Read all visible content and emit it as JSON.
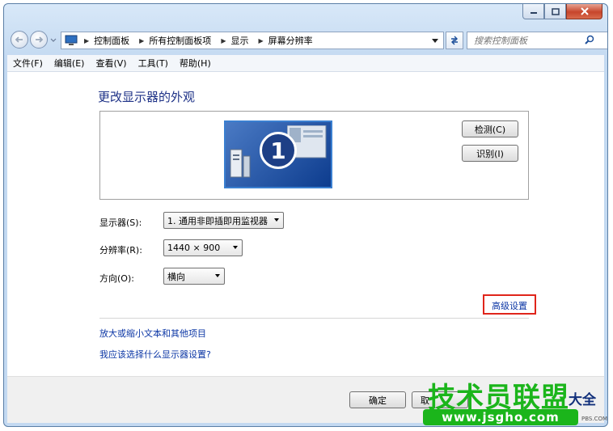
{
  "address": {
    "segments": [
      "控制面板",
      "所有控制面板项",
      "显示",
      "屏幕分辨率"
    ],
    "search_placeholder": "搜索控制面板"
  },
  "menu": [
    "文件(F)",
    "编辑(E)",
    "查看(V)",
    "工具(T)",
    "帮助(H)"
  ],
  "page": {
    "title": "更改显示器的外观",
    "monitor_number": "1",
    "detect_button": "检测(C)",
    "identify_button": "识别(I)",
    "display_label": "显示器(S):",
    "display_value": "1. 通用非即插即用监视器",
    "resolution_label": "分辨率(R):",
    "resolution_value": "1440 × 900",
    "orientation_label": "方向(O):",
    "orientation_value": "横向",
    "advanced_link": "高级设置",
    "link_text_size": "放大或缩小文本和其他项目",
    "link_which_settings": "我应该选择什么显示器设置?"
  },
  "footer": {
    "ok_button": "确定",
    "cancel_button_partial": "取"
  },
  "watermark": {
    "main": "技术员联盟",
    "url": "www.jsgho.com",
    "side": "大全",
    "small": "PBS.COM"
  },
  "colors": {
    "title_blue": "#1e3287",
    "link_blue": "#0b36a5",
    "highlight_red": "#e0251b",
    "watermark_green": "#1bb51b"
  }
}
